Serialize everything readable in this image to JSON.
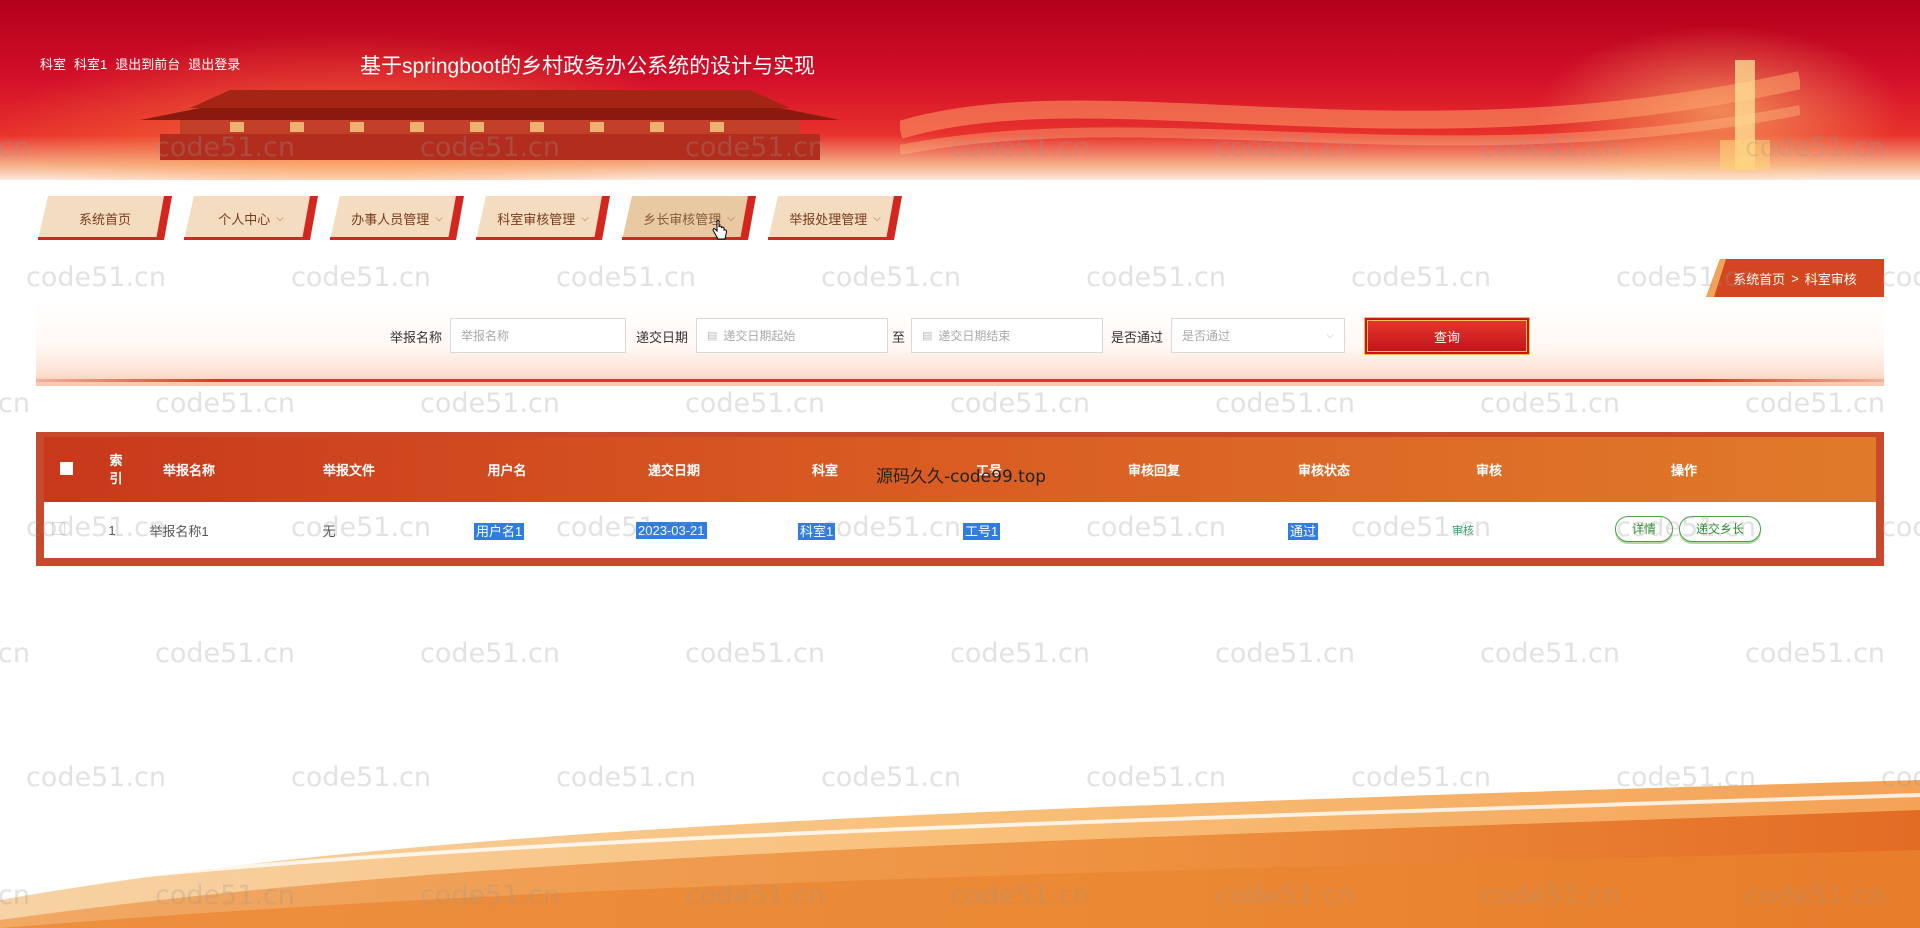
{
  "header": {
    "user_role": "科室",
    "user_name": "科室1",
    "link_frontend": "退出到前台",
    "link_logout": "退出登录",
    "title": "基于springboot的乡村政务办公系统的设计与实现"
  },
  "nav": {
    "items": [
      {
        "label": "系统首页",
        "has_dropdown": false
      },
      {
        "label": "个人中心",
        "has_dropdown": true
      },
      {
        "label": "办事人员管理",
        "has_dropdown": true
      },
      {
        "label": "科室审核管理",
        "has_dropdown": true
      },
      {
        "label": "乡长审核管理",
        "has_dropdown": true,
        "hovered": true
      },
      {
        "label": "举报处理管理",
        "has_dropdown": true
      }
    ]
  },
  "breadcrumb": {
    "home": "系统首页",
    "separator": ">",
    "current": "科室审核"
  },
  "search": {
    "name_label": "举报名称",
    "name_placeholder": "举报名称",
    "date_label": "递交日期",
    "date_start_placeholder": "递交日期起始",
    "date_to": "至",
    "date_end_placeholder": "递交日期结束",
    "pass_label": "是否通过",
    "pass_placeholder": "是否通过",
    "button": "查询"
  },
  "table": {
    "headers": [
      "索引",
      "举报名称",
      "举报文件",
      "用户名",
      "递交日期",
      "科室",
      "工号",
      "审核回复",
      "审核状态",
      "审核",
      "操作"
    ],
    "rows": [
      {
        "index": "1",
        "name": "举报名称1",
        "file": "无",
        "username": "用户名1",
        "date": "2023-03-21",
        "department": "科室1",
        "job_no": "工号1",
        "reply": "",
        "status": "通过",
        "audit": "审核",
        "actions": [
          "详情",
          "递交乡长"
        ]
      }
    ]
  },
  "overlay_text": "源码久久-code99.top",
  "watermark": "code51.cn",
  "colors": {
    "banner_red": "#d4102a",
    "table_head_start": "#c8381c",
    "table_head_end": "#e07a2a",
    "button_red": "#c0101a",
    "highlight": "#2f7de1",
    "action_green": "#4aa34a"
  }
}
